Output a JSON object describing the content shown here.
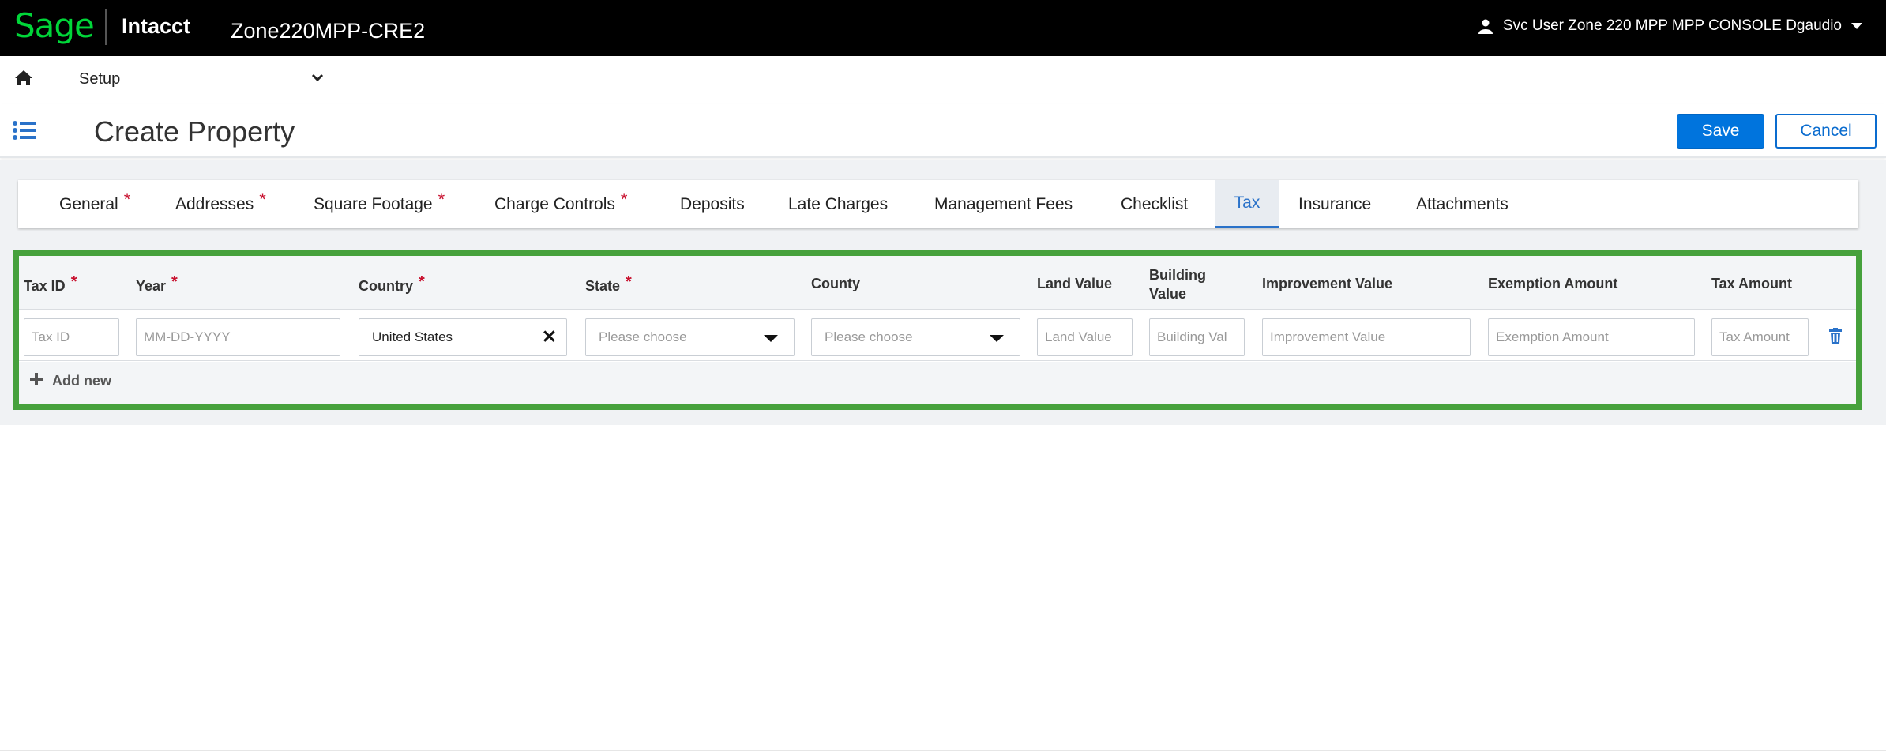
{
  "topbar": {
    "brand": "Sage",
    "product": "Intacct",
    "company": "Zone220MPP-CRE2",
    "user": "Svc User Zone 220 MPP MPP CONSOLE Dgaudio"
  },
  "nav": {
    "module": "Setup"
  },
  "page": {
    "title": "Create Property",
    "save_label": "Save",
    "cancel_label": "Cancel"
  },
  "tabs": [
    {
      "label": "General",
      "required": "*"
    },
    {
      "label": "Addresses",
      "required": "*"
    },
    {
      "label": "Square Footage",
      "required": "*"
    },
    {
      "label": "Charge Controls",
      "required": "*"
    },
    {
      "label": "Deposits"
    },
    {
      "label": "Late Charges"
    },
    {
      "label": "Management Fees"
    },
    {
      "label": "Checklist"
    },
    {
      "label": "Tax",
      "active": true
    },
    {
      "label": "Insurance"
    },
    {
      "label": "Attachments"
    }
  ],
  "tax_table": {
    "columns": [
      {
        "label": "Tax ID",
        "required": "*"
      },
      {
        "label": "Year",
        "required": "*"
      },
      {
        "label": "Country",
        "required": "*"
      },
      {
        "label": "State",
        "required": "*"
      },
      {
        "label": "County"
      },
      {
        "label": "Land Value"
      },
      {
        "label": "Building",
        "label2": "Value"
      },
      {
        "label": "Improvement Value"
      },
      {
        "label": "Exemption Amount"
      },
      {
        "label": "Tax Amount"
      }
    ],
    "row": {
      "tax_id_placeholder": "Tax ID",
      "year_placeholder": "MM-DD-YYYY",
      "country_value": "United States",
      "state_placeholder": "Please choose",
      "county_placeholder": "Please choose",
      "land_value_placeholder": "Land Value",
      "building_value_placeholder": "Building Val",
      "improvement_value_placeholder": "Improvement Value",
      "exemption_amount_placeholder": "Exemption Amount",
      "tax_amount_placeholder": "Tax Amount"
    },
    "add_new_label": "Add new"
  },
  "colors": {
    "brand_green": "#00d639",
    "primary_blue": "#0074dd",
    "required_red": "#c8102e",
    "highlight_green": "#46a13c"
  }
}
